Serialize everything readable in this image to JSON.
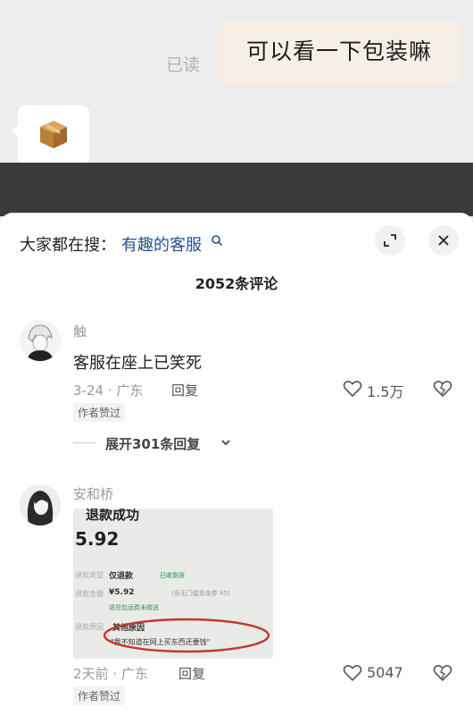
{
  "chat": {
    "read_status": "已读",
    "message": "可以看一下包装嘛"
  },
  "sheet": {
    "search_prefix": "大家都在搜：",
    "search_term": "有趣的客服",
    "comment_count_label": "2052条评论",
    "comments": [
      {
        "username": "触",
        "text": "客服在座上已笑死",
        "date_location": "3-24 · 广东",
        "reply_label": "回复",
        "badge": "作者赞过",
        "likes": "1.5万",
        "expand_replies_label": "展开301条回复"
      },
      {
        "username": "安和桥",
        "date_location": "2天前 · 广东",
        "reply_label": "回复",
        "badge": "作者赞过",
        "likes": "5047",
        "image": {
          "title": "退款成功",
          "amount": "5.92",
          "row1_label": "退款类型",
          "row1_value": "仅退款",
          "row1_tag": "已收到货",
          "row2_label": "退款金额",
          "row2_value": "¥5.92",
          "row2_note": "(含无门槛现金券 ¥5)",
          "note": "退货包运费未赠送",
          "row3_label": "退款原因",
          "reason": "其他原因",
          "quote": "\"我不知道在网上买东西还要钱\""
        }
      }
    ]
  },
  "colors": {
    "link_blue": "#24528f",
    "bubble_bg": "#f6efe6",
    "circle_red": "#c23a2a"
  }
}
